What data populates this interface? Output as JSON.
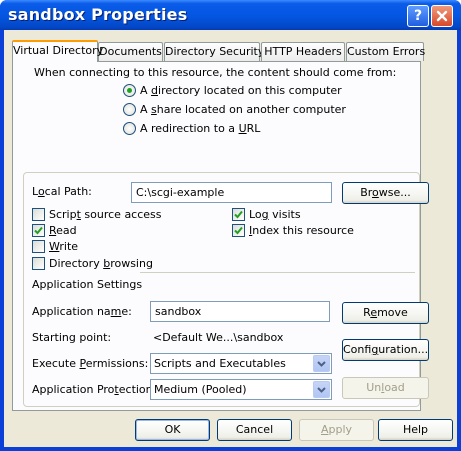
{
  "window": {
    "title": "sandbox Properties"
  },
  "tabs": [
    {
      "label": "Virtual Directory"
    },
    {
      "label": "Documents"
    },
    {
      "label": "Directory Security"
    },
    {
      "label": "HTTP Headers"
    },
    {
      "label": "Custom Errors"
    }
  ],
  "content_source": {
    "prompt": "When connecting to this resource, the content should come from:",
    "options": [
      {
        "pre": "A ",
        "key": "d",
        "post": "irectory located on this computer",
        "selected": true
      },
      {
        "pre": "A ",
        "key": "s",
        "post": "hare located on another computer",
        "selected": false
      },
      {
        "pre": "A redirection to a ",
        "key": "U",
        "post": "RL",
        "selected": false
      }
    ]
  },
  "local_path": {
    "label_pre": "L",
    "label_key": "o",
    "label_post": "cal Path:",
    "value": "C:\\scgi-example",
    "browse": {
      "pre": "Br",
      "key": "o",
      "post": "wse..."
    }
  },
  "permissions": {
    "script_source": {
      "pre": "Scrip",
      "key": "t",
      "post": " source access",
      "checked": false
    },
    "read": {
      "pre": "",
      "key": "R",
      "post": "ead",
      "checked": true
    },
    "write": {
      "pre": "",
      "key": "W",
      "post": "rite",
      "checked": false
    },
    "browsing": {
      "pre": "Directory ",
      "key": "b",
      "post": "rowsing",
      "checked": false
    },
    "log_visits": {
      "pre": "Lo",
      "key": "g",
      "post": " visits",
      "checked": true
    },
    "index": {
      "pre": "",
      "key": "I",
      "post": "ndex this resource",
      "checked": true
    }
  },
  "app_settings": {
    "heading": "Application Settings",
    "app_name": {
      "label_pre": "Application na",
      "label_key": "m",
      "label_post": "e:",
      "value": "sandbox"
    },
    "starting_point": {
      "label": "Starting point:",
      "value": "<Default We...\\sandbox"
    },
    "execute": {
      "label_pre": "Execute ",
      "label_key": "P",
      "label_post": "ermissions:",
      "value": "Scripts and Executables"
    },
    "protection": {
      "label_pre": "Application Pro",
      "label_key": "t",
      "label_post": "ection:",
      "value": "Medium (Pooled)"
    },
    "remove": {
      "pre": "R",
      "key": "e",
      "post": "move"
    },
    "configuration": {
      "pre": "Confi",
      "key": "g",
      "post": "uration..."
    },
    "unload": {
      "pre": "Un",
      "key": "l",
      "post": "oad"
    }
  },
  "footer": {
    "ok": "OK",
    "cancel": "Cancel",
    "apply": {
      "pre": "",
      "key": "A",
      "post": "pply"
    },
    "help": "Help"
  }
}
